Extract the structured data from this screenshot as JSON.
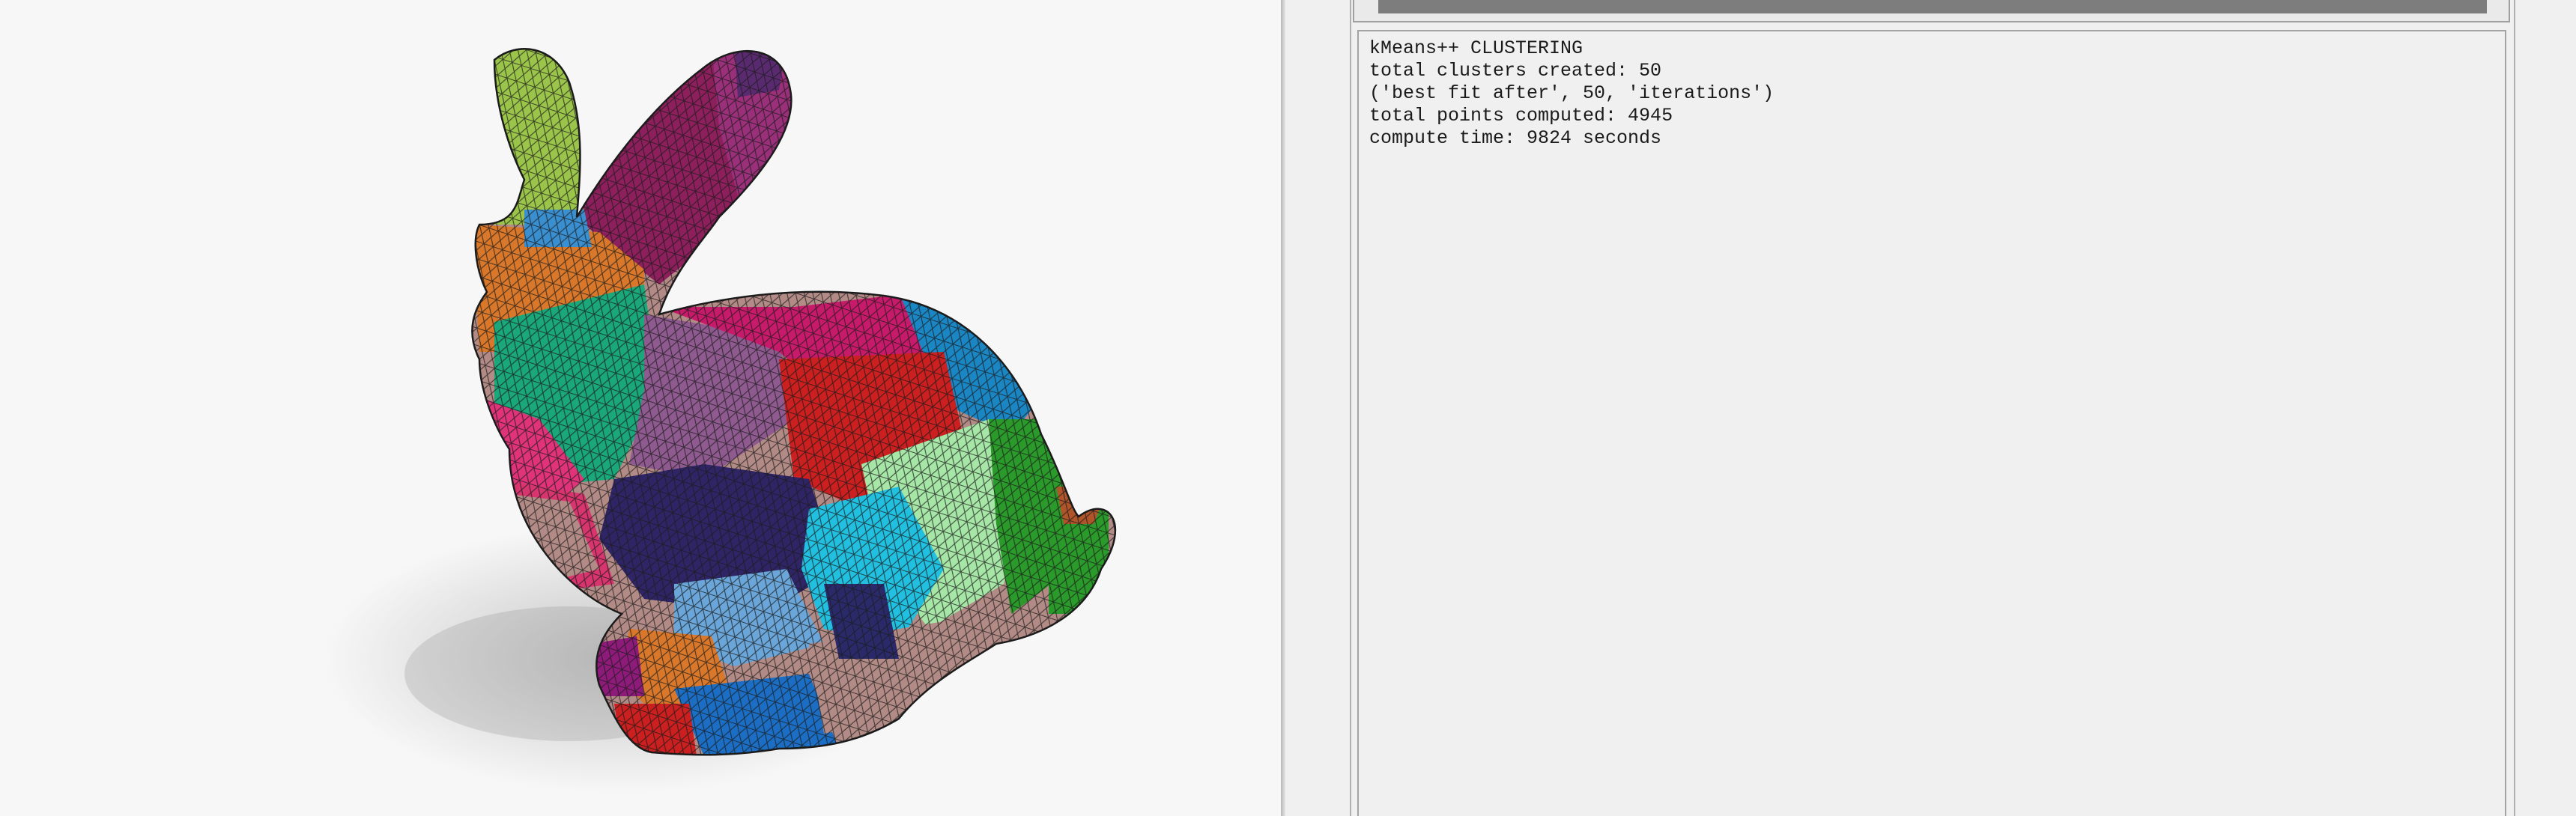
{
  "console": {
    "lines": [
      "kMeans++ CLUSTERING",
      "total clusters created: 50",
      "('best fit after', 50, 'iterations')",
      "total points computed: 4945",
      "compute time: 9824 seconds"
    ]
  },
  "viewport": {
    "model": "bunny-mesh",
    "background": "#f7f7f7",
    "cluster_colors": [
      "#9bc54a",
      "#8c1f5c",
      "#d9782a",
      "#1aa77a",
      "#cc1f1f",
      "#2f2566",
      "#1b86c4",
      "#e0337a",
      "#b38b86",
      "#a6e6a6",
      "#22c0e0",
      "#2a9a2a",
      "#6aa6d9",
      "#8e3a8e",
      "#d8356e"
    ]
  }
}
